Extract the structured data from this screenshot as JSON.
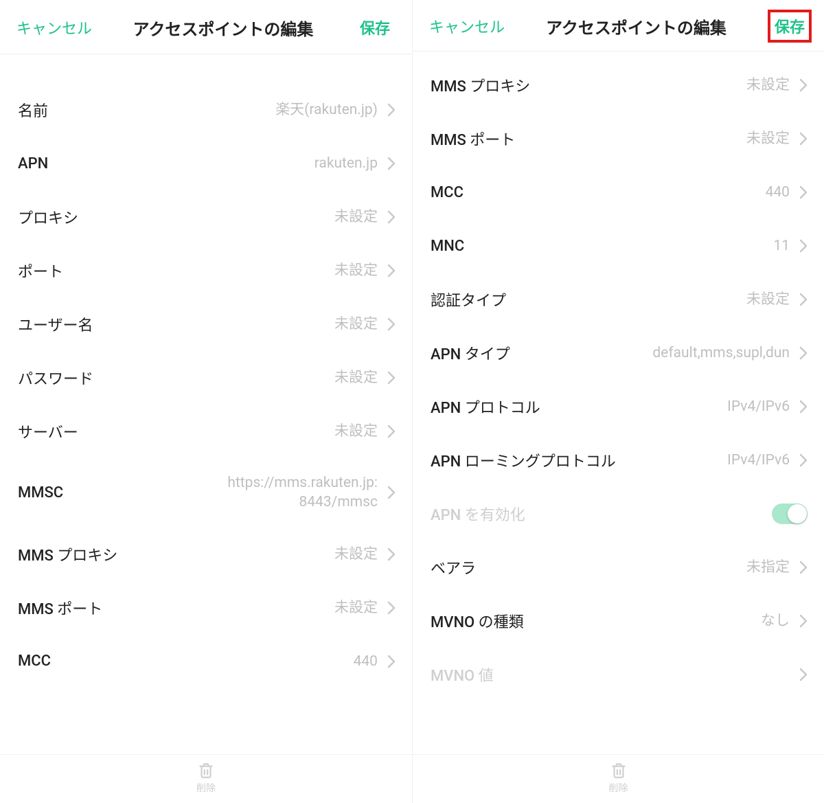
{
  "left": {
    "header": {
      "cancel": "キャンセル",
      "title": "アクセスポイントの編集",
      "save": "保存"
    },
    "rows": [
      {
        "label": "名前",
        "value": "楽天(rakuten.jp)"
      },
      {
        "label": "APN",
        "value": "rakuten.jp"
      },
      {
        "label": "プロキシ",
        "value": "未設定"
      },
      {
        "label": "ポート",
        "value": "未設定"
      },
      {
        "label": "ユーザー名",
        "value": "未設定"
      },
      {
        "label": "パスワード",
        "value": "未設定"
      },
      {
        "label": "サーバー",
        "value": "未設定"
      },
      {
        "label": "MMSC",
        "value": "https://mms.rakuten.jp:8443/mmsc"
      },
      {
        "label": "MMS プロキシ",
        "value": "未設定"
      },
      {
        "label": "MMS ポート",
        "value": "未設定"
      },
      {
        "label": "MCC",
        "value": "440"
      }
    ],
    "footer": {
      "delete": "削除"
    }
  },
  "right": {
    "header": {
      "cancel": "キャンセル",
      "title": "アクセスポイントの編集",
      "save": "保存"
    },
    "rows": [
      {
        "label": "MMS プロキシ",
        "value": "未設定"
      },
      {
        "label": "MMS ポート",
        "value": "未設定"
      },
      {
        "label": "MCC",
        "value": "440"
      },
      {
        "label": "MNC",
        "value": "11"
      },
      {
        "label": "認証タイプ",
        "value": "未設定"
      },
      {
        "label": "APN タイプ",
        "value": "default,mms,supl,dun"
      },
      {
        "label": "APN プロトコル",
        "value": "IPv4/IPv6"
      },
      {
        "label": "APN ローミングプロトコル",
        "value": "IPv4/IPv6"
      },
      {
        "label": "APN を有効化",
        "toggle": true
      },
      {
        "label": "ベアラ",
        "value": "未指定"
      },
      {
        "label": "MVNO の種類",
        "value": "なし"
      },
      {
        "label": "MVNO 値",
        "value": "",
        "disabled": true
      }
    ],
    "footer": {
      "delete": "削除"
    },
    "highlight_save": true
  }
}
